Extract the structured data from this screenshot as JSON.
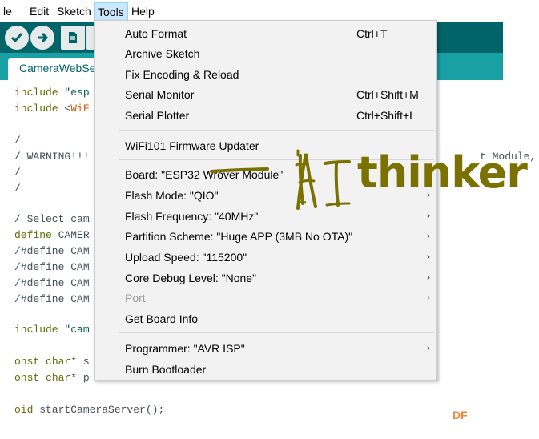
{
  "menubar": {
    "items": [
      {
        "label": "le"
      },
      {
        "label": "Edit"
      },
      {
        "label": "Sketch"
      },
      {
        "label": "Tools"
      },
      {
        "label": "Help"
      }
    ]
  },
  "tab": {
    "label": "CameraWebSe"
  },
  "code": {
    "lines": [
      {
        "prefix": "include ",
        "str": "\"esp"
      },
      {
        "prefix": "include ",
        "str": "<",
        "orange": "WiF"
      },
      {
        "text": ""
      },
      {
        "cmt": "/"
      },
      {
        "cmt": "/ WARNING!!!",
        "tail": "t Module,"
      },
      {
        "cmt": "/"
      },
      {
        "cmt": "/"
      },
      {
        "text": ""
      },
      {
        "cmt": "/ Select cam"
      },
      {
        "prefix": "define ",
        "plain": "CAMER"
      },
      {
        "cmt": "/#define CAM"
      },
      {
        "cmt": "/#define CAM"
      },
      {
        "cmt": "/#define CAM"
      },
      {
        "cmt": "/#define CAM"
      },
      {
        "text": ""
      },
      {
        "prefix": "include ",
        "str": "\"cam"
      },
      {
        "text": ""
      },
      {
        "prefix": "onst ",
        "kw2": "char",
        "plain": "* s"
      },
      {
        "prefix": "onst ",
        "kw2": "char",
        "plain": "* p"
      },
      {
        "text": ""
      },
      {
        "prefix": "oid ",
        "plain": "startCameraServer();"
      }
    ]
  },
  "tools_menu": {
    "items": [
      {
        "label": "Auto Format",
        "shortcut": "Ctrl+T"
      },
      {
        "label": "Archive Sketch",
        "shortcut": ""
      },
      {
        "label": "Fix Encoding & Reload",
        "shortcut": ""
      },
      {
        "label": "Serial Monitor",
        "shortcut": "Ctrl+Shift+M"
      },
      {
        "label": "Serial Plotter",
        "shortcut": "Ctrl+Shift+L"
      },
      {
        "label": "WiFi101 Firmware Updater",
        "shortcut": ""
      },
      {
        "label": "Board: \"ESP32 Wrover Module\"",
        "arrow": "›"
      },
      {
        "label": "Flash Mode: \"QIO\"",
        "arrow": "›"
      },
      {
        "label": "Flash Frequency: \"40MHz\"",
        "arrow": "›"
      },
      {
        "label": "Partition Scheme: \"Huge APP (3MB No OTA)\"",
        "arrow": "›"
      },
      {
        "label": "Upload Speed: \"115200\"",
        "arrow": "›"
      },
      {
        "label": "Core Debug Level: \"None\"",
        "arrow": "›"
      },
      {
        "label": "Port",
        "arrow": "›",
        "disabled": true
      },
      {
        "label": "Get Board Info",
        "shortcut": ""
      },
      {
        "label": "Programmer: \"AVR ISP\"",
        "arrow": "›"
      },
      {
        "label": "Burn Bootloader",
        "shortcut": ""
      }
    ]
  },
  "watermark": {
    "ai": "AI",
    "brand": "thinker",
    "df": "DF"
  },
  "colors": {
    "toolbar": "#006468",
    "tabstrip": "#17a1a5",
    "brand": "#7b7100",
    "highlight": "#cce8ff"
  }
}
